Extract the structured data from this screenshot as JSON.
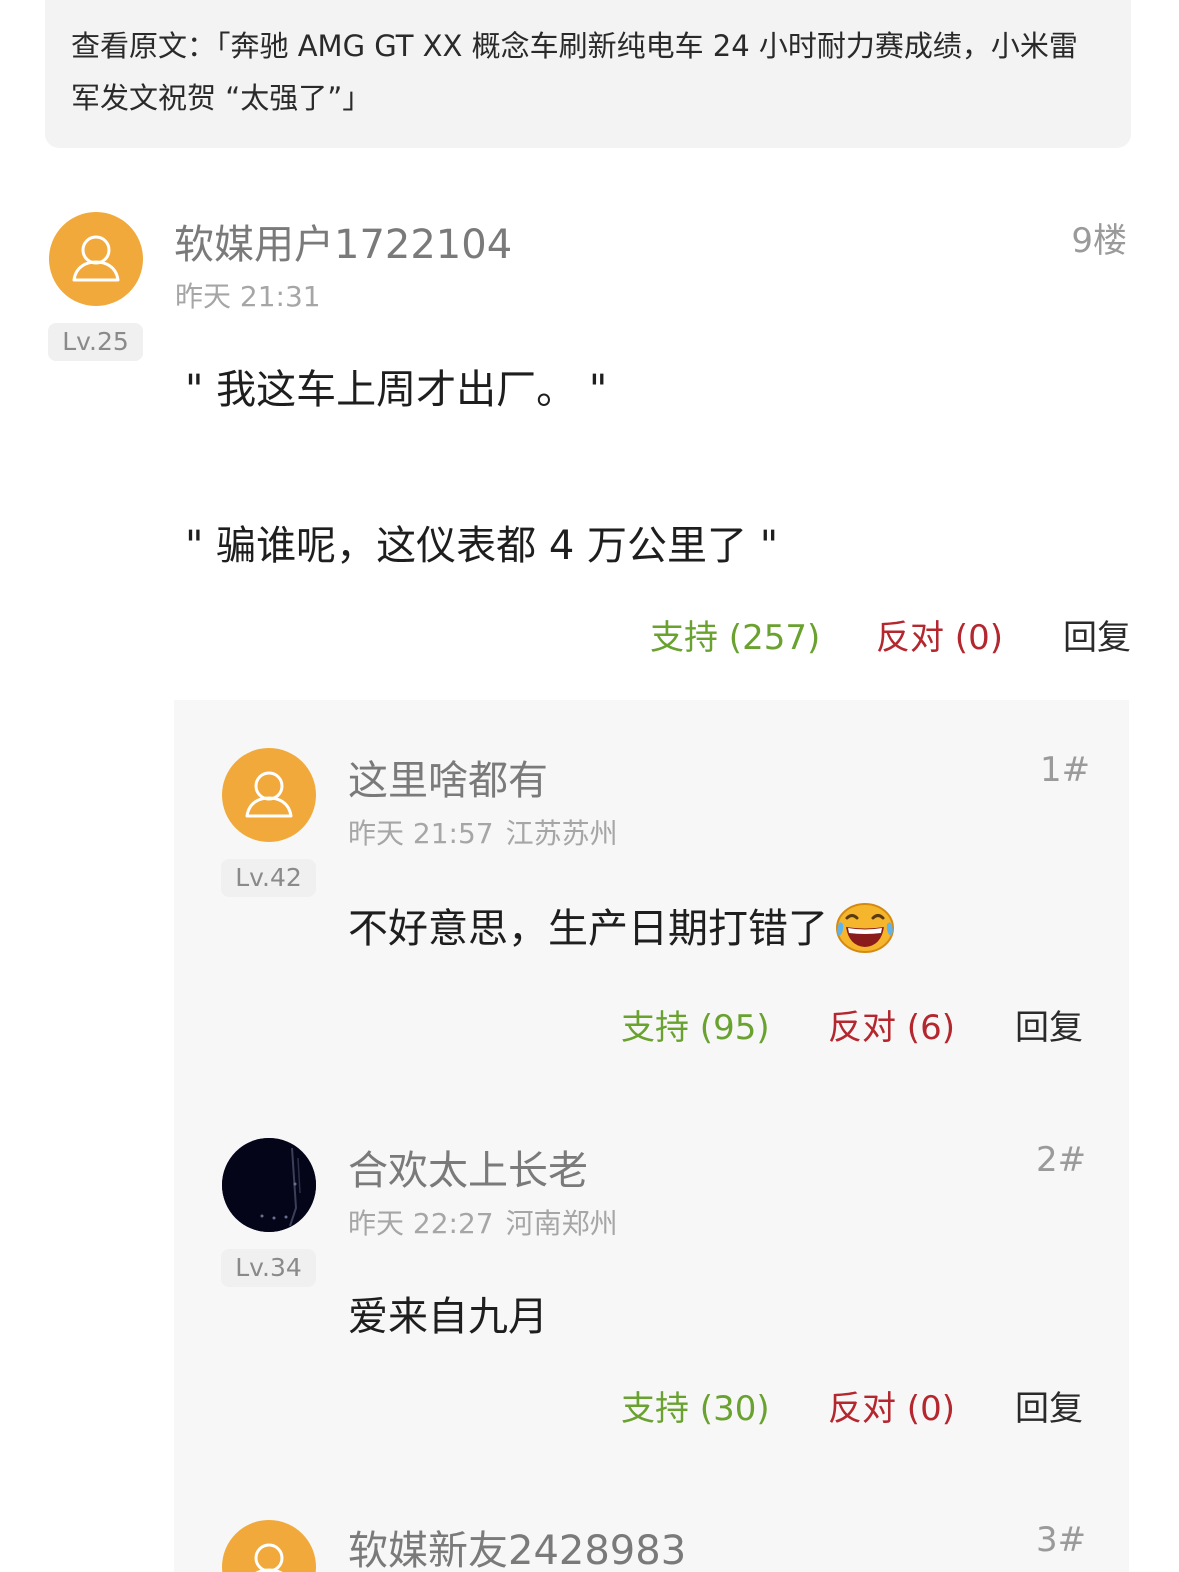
{
  "source": {
    "line1": "查看原文：「奔驰 AMG GT XX 概念车刷新纯电车 24 小时耐力赛成绩，小米雷",
    "line2": "军发文祝贺 “太强了”」"
  },
  "main_comment": {
    "username": "软媒用户1722104",
    "time": "昨天 21:31",
    "level": "Lv.25",
    "floor": "9楼",
    "line1": "\" 我这车上周才出厂。 \"",
    "line2": "\" 骗谁呢，这仪表都 4 万公里了 \"",
    "support": "支持 (257)",
    "oppose": "反对 (0)",
    "reply": "回复"
  },
  "replies": [
    {
      "username": "这里啥都有",
      "time": "昨天 21:57",
      "location": "江苏苏州",
      "level": "Lv.42",
      "floor": "1#",
      "text": "不好意思，生产日期打错了",
      "emoji": "laughing-tears-icon",
      "support": "支持 (95)",
      "oppose": "反对 (6)",
      "reply": "回复"
    },
    {
      "username": "合欢太上长老",
      "time": "昨天 22:27",
      "location": "河南郑州",
      "level": "Lv.34",
      "floor": "2#",
      "text": "爱来自九月",
      "support": "支持 (30)",
      "oppose": "反对 (0)",
      "reply": "回复"
    },
    {
      "username": "软媒新友2428983",
      "floor": "3#"
    }
  ],
  "colors": {
    "support": "#6aa230",
    "oppose": "#b4272e",
    "avatar": "#f0a93a",
    "panel": "#f7f7f7"
  }
}
